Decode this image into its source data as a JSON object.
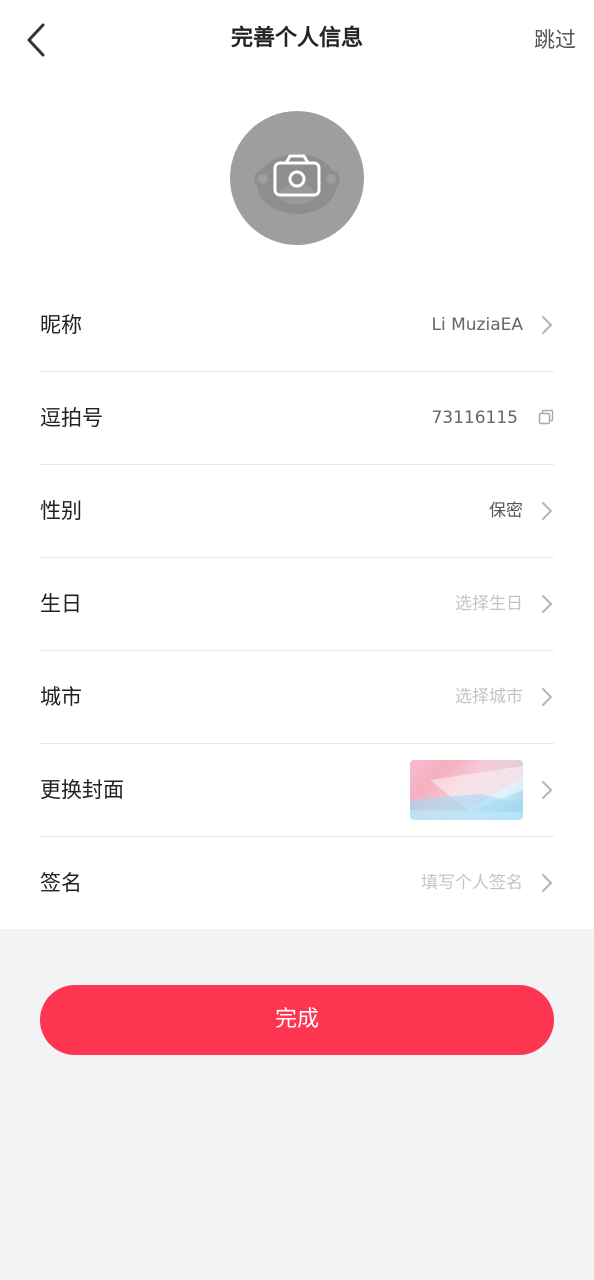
{
  "header": {
    "title": "完善个人信息",
    "skip_label": "跳过"
  },
  "rows": [
    {
      "label": "昵称",
      "value": "Li MuziaEA"
    },
    {
      "label": "逗拍号",
      "value": "73116115"
    },
    {
      "label": "性别",
      "value": "保密"
    },
    {
      "label": "生日",
      "value": "选择生日"
    },
    {
      "label": "城市",
      "value": "选择城市"
    },
    {
      "label": "更换封面",
      "value": ""
    },
    {
      "label": "签名",
      "value": "填写个人签名"
    }
  ],
  "done_label": "完成",
  "colors": {
    "accent": "#fe3551",
    "background": "#f2f3f5",
    "avatar_bg": "#9e9e9e"
  }
}
